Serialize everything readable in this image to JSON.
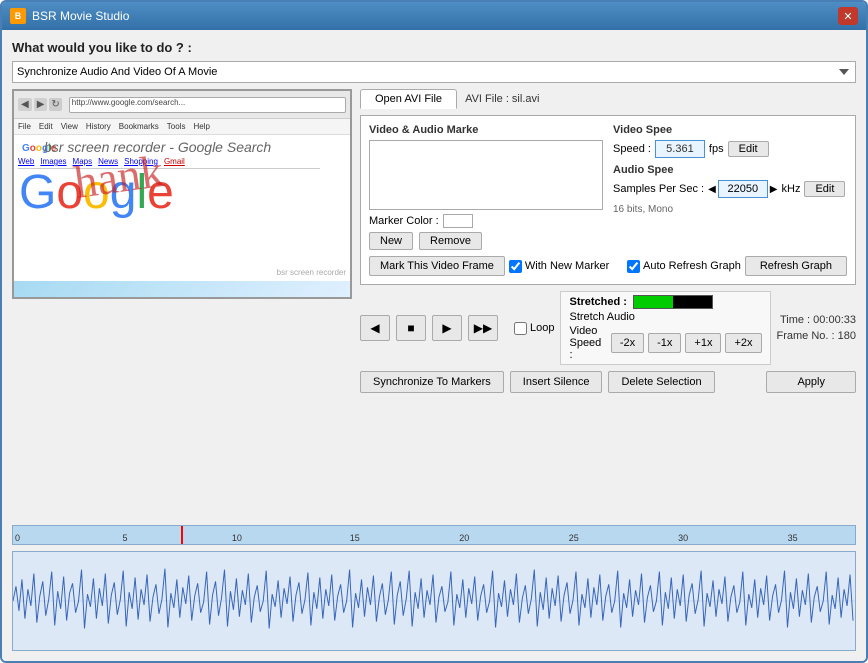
{
  "window": {
    "title": "BSR Movie Studio",
    "close_label": "✕"
  },
  "question": {
    "label": "What would you like to do ? :"
  },
  "dropdown": {
    "value": "Synchronize Audio And Video Of A Movie"
  },
  "tabs": {
    "open_avi": "Open AVI File",
    "avi_file": "AVI File  :  sil.avi"
  },
  "marker_section": {
    "title": "Video & Audio Marke",
    "color_label": "Marker Color :",
    "new_btn": "New",
    "remove_btn": "Remove"
  },
  "video_speed": {
    "title": "Video Spee",
    "speed_label": "Speed :",
    "speed_value": "5.361",
    "fps_label": "fps",
    "edit_label": "Edit"
  },
  "audio_speed": {
    "title": "Audio Spee",
    "samples_label": "Samples Per Sec :",
    "samples_value": "22050",
    "khz_label": "kHz",
    "edit_label": "Edit",
    "bits_label": "16 bits, Mono"
  },
  "mark_frame": {
    "btn_label": "Mark This Video Frame",
    "checkbox_label": "With New Marker",
    "auto_refresh_label": "Auto Refresh Graph",
    "refresh_btn": "Refresh Graph"
  },
  "transport": {
    "prev": "◀",
    "stop": "■",
    "play": "▶",
    "next": "▶▶",
    "loop_label": "Loop"
  },
  "time_info": {
    "time_label": "Time : 00:00:33",
    "frame_label": "Frame No. : 180"
  },
  "action_buttons": {
    "sync": "Synchronize To Markers",
    "insert": "Insert Silence",
    "delete": "Delete Selection"
  },
  "stretch_audio": {
    "title": "Stretch Audio",
    "speed_label": "Video Speed :",
    "btn_2x_minus": "-2x",
    "btn_1x_minus": "-1x",
    "btn_1x_plus": "+1x",
    "btn_2x_plus": "+2x",
    "apply_label": "Apply",
    "stretched_label": "Stretched :"
  },
  "timeline": {
    "ticks": [
      "0",
      "5",
      "10",
      "15",
      "20",
      "25",
      "30",
      "35"
    ]
  }
}
